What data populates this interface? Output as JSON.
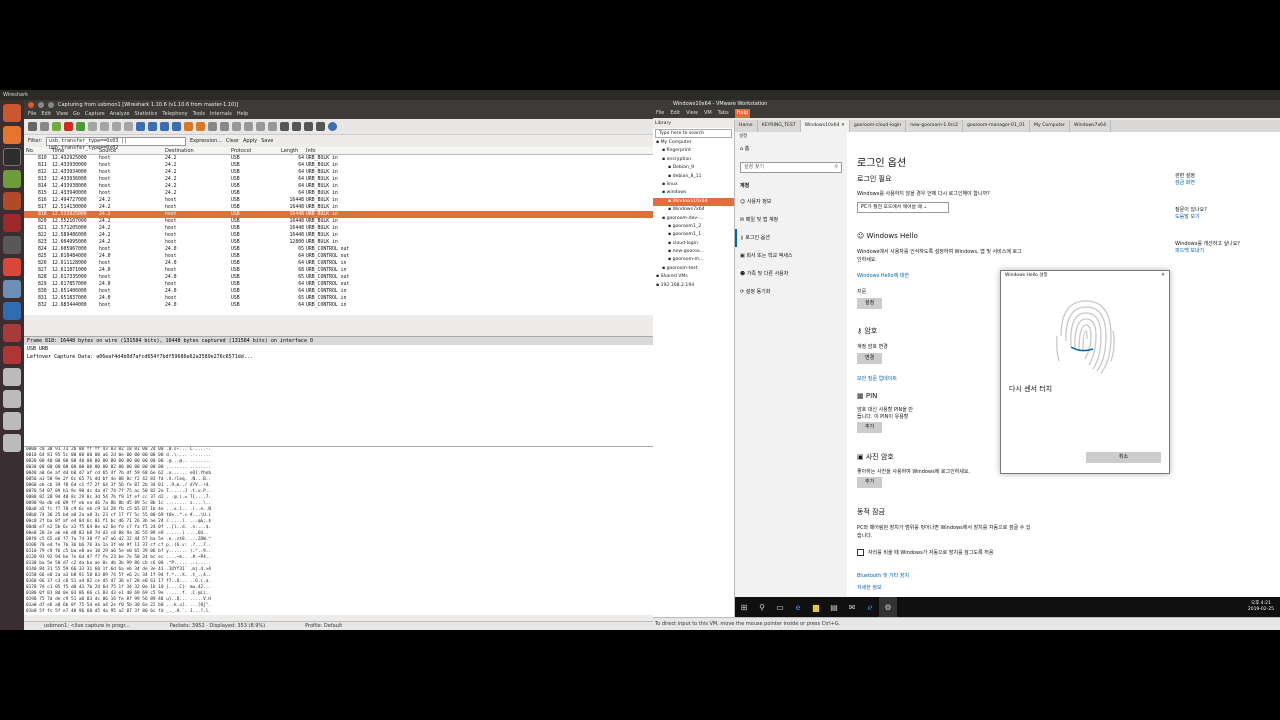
{
  "os": {
    "topbar_label": "Wireshark"
  },
  "wireshark": {
    "title": "Capturing from usbmon1   [Wireshark 1.10.6  (v1.10.6 from master-1.10)]",
    "menu": [
      "File",
      "Edit",
      "View",
      "Go",
      "Capture",
      "Analyze",
      "Statistics",
      "Telephony",
      "Tools",
      "Internals",
      "Help"
    ],
    "filter_label": "Filter:",
    "filter_value": "usb.transfer_type==0x03 || usb.transfer_type==0x02",
    "filter_buttons": [
      "Expression...",
      "Clear",
      "Apply",
      "Save"
    ],
    "columns": [
      "No.",
      "Time",
      "Source",
      "Destination",
      "Protocol",
      "Length",
      "Info"
    ],
    "packets": [
      [
        "810",
        "12.432925000",
        "host",
        "24.2",
        "USB",
        "64",
        "URB_BULK in"
      ],
      [
        "811",
        "12.433930000",
        "host",
        "24.2",
        "USB",
        "64",
        "URB_BULK in"
      ],
      [
        "812",
        "12.433934000",
        "host",
        "24.2",
        "USB",
        "64",
        "URB_BULK in"
      ],
      [
        "813",
        "12.433936000",
        "host",
        "24.2",
        "USB",
        "64",
        "URB_BULK in"
      ],
      [
        "814",
        "12.433938000",
        "host",
        "24.2",
        "USB",
        "64",
        "URB_BULK in"
      ],
      [
        "815",
        "12.433940000",
        "host",
        "24.2",
        "USB",
        "64",
        "URB_BULK in"
      ],
      [
        "816",
        "12.494727000",
        "24.2",
        "host",
        "USB",
        "16448",
        "URB_BULK in"
      ],
      [
        "817",
        "12.514130000",
        "24.2",
        "host",
        "USB",
        "16448",
        "URB_BULK in"
      ],
      [
        "818",
        "12.533925000",
        "24.2",
        "host",
        "USB",
        "16448",
        "URB_BULK in"
      ],
      [
        "820",
        "12.552107000",
        "24.2",
        "host",
        "USB",
        "16448",
        "URB_BULK in"
      ],
      [
        "821",
        "12.571205000",
        "24.2",
        "host",
        "USB",
        "16448",
        "URB_BULK in"
      ],
      [
        "822",
        "12.589486000",
        "24.2",
        "host",
        "USB",
        "16448",
        "URB_BULK in"
      ],
      [
        "823",
        "12.604995000",
        "24.2",
        "host",
        "USB",
        "12800",
        "URB_BULK in"
      ],
      [
        "824",
        "12.605967000",
        "host",
        "24.0",
        "USB",
        "65",
        "URB_CONTROL out"
      ],
      [
        "825",
        "12.610484000",
        "24.0",
        "host",
        "USB",
        "64",
        "URB_CONTROL out"
      ],
      [
        "826",
        "12.611128000",
        "host",
        "24.0",
        "USB",
        "64",
        "URB_CONTROL in"
      ],
      [
        "827",
        "12.611871000",
        "24.0",
        "host",
        "USB",
        "68",
        "URB_CONTROL in"
      ],
      [
        "828",
        "12.617335000",
        "host",
        "24.0",
        "USB",
        "65",
        "URB_CONTROL out"
      ],
      [
        "829",
        "12.617857000",
        "24.0",
        "host",
        "USB",
        "64",
        "URB_CONTROL out"
      ],
      [
        "830",
        "12.651406000",
        "host",
        "24.0",
        "USB",
        "64",
        "URB_CONTROL in"
      ],
      [
        "831",
        "12.651837000",
        "24.0",
        "host",
        "USB",
        "65",
        "URB_CONTROL in"
      ],
      [
        "832",
        "12.683444000",
        "host",
        "24.0",
        "USB",
        "64",
        "URB_CONTROL in"
      ]
    ],
    "selected_index": 8,
    "detail_lines": [
      "Frame 818: 16448 bytes on wire (131584 bits), 16448 bytes captured (131584 bits) on interface 0",
      "USB URB",
      "  Leftover Capture Data: a06eaf4d4b0d7afcd654f7bdf59686e62a3589e276c6571dd..."
    ],
    "hex_lines": [
      "0000  c0 30 91 73 2b 80 ff ff  43 03 82 18 01 00 2d 00   .0.s+...  C.....-.",
      "0010  64 81 95 5c 00 00 00 00  a6 2d 0e 00 00 00 00 00   d..\\....  .-......",
      "0020  00 40 00 00 00 40 00 00  00 00 00 00 00 00 00 00   .@...@..  ........",
      "0030  00 00 00 00 00 00 00 00  00 02 00 00 00 00 00 00   ........  ........",
      "0040  a0 6e af d4 b0 d7 af cd  65 4f 7b df 59 68 6e 62   .n......  eO{.Yhnb",
      "0050  a3 58 9e 2f 6c 65 71 dd  bf 4e 88 8c f2 42 83 fd   .X./leq.  .N...B..",
      "0060  eb cb 39 f8 6d c1 f7 2f  64 3f 56 fe 07 2b 34 01   ..9.m../  d?V..+4.",
      "0070  54 07 89 b1 9c 90 dc 4a  d7 74 7f 75 ac 50 82 2e   T......J  .t.u.P..",
      "0080  82 20 9d 40 8c 29 0c 3d  54 7b f9 1f ef cc 37 d2   . .@.).=  T{....7.",
      "0090  9a db e6 09 ff eb ea d6  7a 8b 8b d5 89 5c 8b 1c   ........  z....\\..",
      "00a0  a5 fc f7 78 c9 6c eb c9  1d 28 fb c5 65 07 1b 4e   ...x.l..  .(..e..N",
      "00b0  74 36 25 bd a8 2a a8 3c  23 cf 17 f7 5c 55 00 69   t6%..*.<  #...\\U.i",
      "00c0  2f ba 8f af e4 04 6c 01  f1 bc d6 71 26 3b ae 24   /.....l.  ...q&;.$",
      "00d0  e7 e2 5b 6c a3 f5 64 8e  a2 6e fe c7 fa f5 24 0f   ..[l..d.  .n....$.",
      "00e0  20 2e a6 e6 d8 83 b8 7d  d3 c8 88 9a 36 55 89 e9    ......}  ....6U..",
      "00f0  c5 65 e6 f7 7a 74 38 f7  e7 a6 d2 32 44 57 ba 5e   .e..zt8.  ...2DW.^",
      "0100  70 e4 fe 7b 36 b6 76 3a  1a 3f e0 9f 11 37 cf cf   p..{6.v:  .?...7..",
      "0110  79 c9 f6 c5 ba e8 ae 10  29 a6 5e e0 b5 39 06 bf   y.......  ).^..9..",
      "0120  91 92 94 be 7e 6d d7 f7  fe 23 be 7e 50 34 bc ec   ....~m..  .#.~P4..",
      "0130  ba 5e 50 d7 c2 da ba ae  8c db 3b 99 86 cb c6 00   .^P.....  ..;.....",
      "0140  84 31 55 59 66 33 31 60  1f 6d 6a eb 34 de 3e 41   .1UYf31`  .mj.4.>A",
      "0150  66 e0 2a a3 b8 91 58 83  09 74 5f e6 2c 34 1f 94   f.*...X.  .t_.,4..",
      "0160  66 37 c3 c0 51 a4 82 ce  d5 d7 36 e7 28 e0 61 17   f7..Q...  ..6.(.a.",
      "0170  7d c1 05 f5 d8 43 7b 2d  6d 75 1f 34 32 0e 1b 10   }....C{-  mu.42...",
      "0180  0f 01 8d 0e 03 86 66 c1  83 43 e1 40 69 69 c5 9e   ......f.  .C.@ii..",
      "0190  75 7d de c9 51 a0 83 dc  86 16 fe 8f 99 56 89 48   u}..Q...  .....V.H",
      "01a0  d7 e6 a8 6b 0f 75 5d e6  a4 2e f0 5b 30 6a 22 b0   ...k.u].  ...[0j\".",
      "01b0  5f fc 5f e7 48 96 60 d5  4a 95 a2 07 3f 80 6c fd   _._.H.`.  J...?.l."
    ],
    "status": {
      "file": "usbmon1: <live capture in progr...",
      "packets": "Packets: 3952 · Displayed: 353 (8.9%)",
      "profile": "Profile: Default"
    }
  },
  "vmware": {
    "title": "Windows10x64 - VMware Workstation",
    "menu": [
      "File",
      "Edit",
      "View",
      "VM",
      "Tabs",
      "Help"
    ],
    "library_label": "Library",
    "library_search": "Type here to search",
    "tree": [
      {
        "label": "My Computer",
        "depth": 0
      },
      {
        "label": "fingerprint",
        "depth": 1
      },
      {
        "label": "encryption",
        "depth": 1
      },
      {
        "label": "Debian_9",
        "depth": 2
      },
      {
        "label": "debian_8_11",
        "depth": 2
      },
      {
        "label": "linux",
        "depth": 1
      },
      {
        "label": "windows",
        "depth": 1
      },
      {
        "label": "Windows10x64",
        "depth": 2
      },
      {
        "label": "Windows7x64",
        "depth": 2
      },
      {
        "label": "gooroom-dev-...",
        "depth": 1
      },
      {
        "label": "gooroom1_2",
        "depth": 2
      },
      {
        "label": "gooroom1_1",
        "depth": 2
      },
      {
        "label": "cloud-login",
        "depth": 2
      },
      {
        "label": "new-gooroo...",
        "depth": 2
      },
      {
        "label": "gooroom-m...",
        "depth": 2
      },
      {
        "label": "gooroom-test",
        "depth": 1
      },
      {
        "label": "Shared VMs",
        "depth": 0
      },
      {
        "label": "192.168.2.194",
        "depth": 0
      }
    ],
    "tree_selected": 7,
    "tabs": [
      "Home",
      "KEYRING_TEST",
      "Windows10x64",
      "gooroom-cloud-login",
      "new-gooroom-1.0rc2",
      "gooroom-manager-01_01",
      "My Computer",
      "Windows7x64"
    ],
    "active_tab": 2,
    "status": "To direct input to this VM, move the mouse pointer inside or press Ctrl+G."
  },
  "settings": {
    "window_label": "설정",
    "search_placeholder": "설정 찾기",
    "side_header": "계정",
    "home": "홈",
    "side_items": [
      "사용자 정보",
      "메일 및 앱 계정",
      "로그인 옵션",
      "회사 또는 학교 액세스",
      "가족 및 다른 사용자",
      "설정 동기화"
    ],
    "side_selected": 2,
    "page_title": "로그인 옵션",
    "req_title": "로그인 필요",
    "req_desc": "Windows를 사용하지 않을 경우 언제 다시 로그인해야 합니까?",
    "req_select": "PC가 절전 모드에서 깨어날 때",
    "hello_title": "Windows Hello",
    "hello_desc": "Windows에서 사용자를 인식하도록 설정하여 Windows, 앱 및 서비스에 로그인하세요.",
    "hello_link": "Windows Hello에 대한",
    "finger_label": "지문",
    "setup_btn": "설정",
    "pw_title": "암호",
    "pw_desc": "계정 암호 변경",
    "change_btn": "변경",
    "security_link": "보안 질문 업데이트",
    "pin_title": "PIN",
    "pin_desc": "암호 대신 사용할 PIN을 만듭니다. 이 PIN이 유용할",
    "add_btn": "추가",
    "pic_title": "사진 암호",
    "pic_desc": "좋아하는 사진을 사용하여 Windows에 로그인하세요.",
    "add_btn2": "추가",
    "dyn_title": "동적 잠금",
    "dyn_desc": "PC와 페어링된 장치가 범위를 벗어나면 Windows에서 장치를 자동으로 잠글 수 있습니다.",
    "dyn_check": "자리를 비울 때 Windows가 자동으로 장치를 잠그도록 허용",
    "bt_link": "Bluetooth 및 기타 장치",
    "more_link": "자세한 정보",
    "right_items": [
      {
        "title": "관련 설정",
        "link": "잠금 화면"
      },
      {
        "title": "질문이 있나요?",
        "link": "도움말 보기"
      },
      {
        "title": "Windows를 개선하고 싶나요?",
        "link": "피드백 보내기"
      }
    ],
    "dialog": {
      "title": "Windows Hello 설정",
      "message": "다시 센서 터치",
      "cancel": "취소"
    },
    "taskbar_time": "오후 4:21",
    "taskbar_date": "2019-02-25"
  },
  "colors": {
    "accent": "#e06f3e",
    "win_blue": "#0063b1"
  }
}
